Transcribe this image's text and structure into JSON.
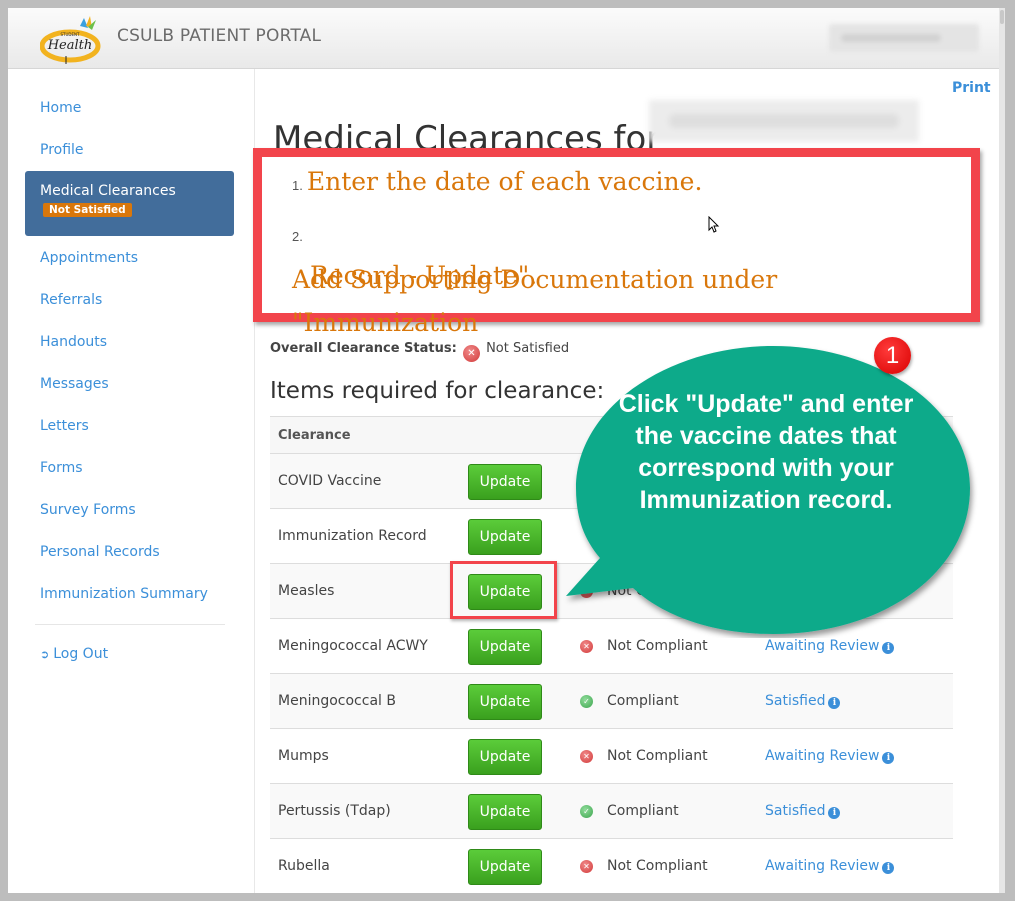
{
  "header": {
    "portal_title": "CSULB PATIENT PORTAL",
    "logo_alt": "Student Health Services"
  },
  "sidebar": {
    "items": [
      {
        "label": "Home"
      },
      {
        "label": "Profile"
      },
      {
        "label": "Medical Clearances",
        "badge": "Not Satisfied",
        "active": true
      },
      {
        "label": "Appointments"
      },
      {
        "label": "Referrals"
      },
      {
        "label": "Handouts"
      },
      {
        "label": "Messages"
      },
      {
        "label": "Letters"
      },
      {
        "label": "Forms"
      },
      {
        "label": "Survey Forms"
      },
      {
        "label": "Personal Records"
      },
      {
        "label": "Immunization Summary"
      }
    ],
    "logout_label": "Log Out"
  },
  "main": {
    "print_label": "Print",
    "title": "Medical Clearances for",
    "instructions": [
      {
        "num": "1.",
        "text": "Enter the date of each vaccine."
      },
      {
        "num": "2.",
        "text_line1": "Add Supporting Documentation under \"Immunization",
        "text_line2": "Record - Update\"."
      }
    ],
    "overall_label": "Overall Clearance Status:",
    "overall_value": "Not Satisfied",
    "section_title": "Items required for clearance:",
    "table": {
      "headers": [
        "Clearance"
      ],
      "button_label": "Update",
      "rows": [
        {
          "name": "COVID Vaccine",
          "compliance": "",
          "status": ""
        },
        {
          "name": "Immunization Record",
          "compliance": "",
          "status": ""
        },
        {
          "name": "Measles",
          "compliance": "Not Compliant",
          "status": ""
        },
        {
          "name": "Meningococcal ACWY",
          "compliance": "Not Compliant",
          "status": "Awaiting Review"
        },
        {
          "name": "Meningococcal B",
          "compliance": "Compliant",
          "status": "Satisfied"
        },
        {
          "name": "Mumps",
          "compliance": "Not Compliant",
          "status": "Awaiting Review"
        },
        {
          "name": "Pertussis (Tdap)",
          "compliance": "Compliant",
          "status": "Satisfied"
        },
        {
          "name": "Rubella",
          "compliance": "Not Compliant",
          "status": "Awaiting Review"
        }
      ]
    }
  },
  "annotation": {
    "number": "1",
    "bubble_text": "Click \"Update\" and enter the vaccine dates that correspond with your Immunization record.",
    "colors": {
      "bubble": "#0aaa8a",
      "highlight": "#f2444b",
      "instruction_text": "#d9770b"
    }
  }
}
